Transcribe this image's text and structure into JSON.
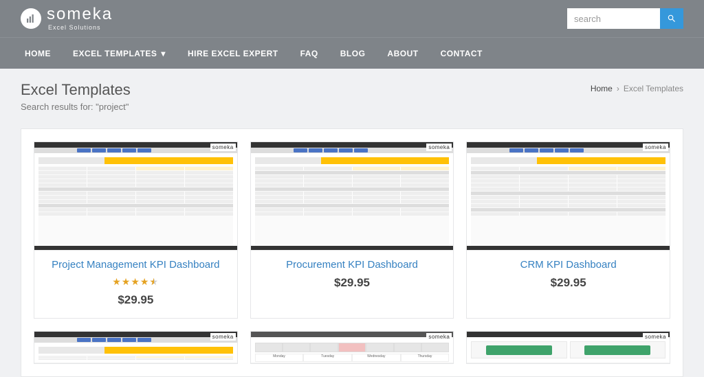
{
  "logo": {
    "main": "someka",
    "sub": "Excel Solutions"
  },
  "search": {
    "placeholder": "search"
  },
  "nav": {
    "home": "HOME",
    "templates": "EXCEL TEMPLATES",
    "hire": "HIRE EXCEL EXPERT",
    "faq": "FAQ",
    "blog": "BLOG",
    "about": "ABOUT",
    "contact": "CONTACT"
  },
  "page": {
    "title": "Excel Templates",
    "subtitle": "Search results for: \"project\""
  },
  "breadcrumb": {
    "home": "Home",
    "current": "Excel Templates"
  },
  "products": [
    {
      "title": "Project Management KPI Dashboard",
      "price": "$29.95",
      "rating": 4.5
    },
    {
      "title": "Procurement KPI Dashboard",
      "price": "$29.95",
      "rating": 0
    },
    {
      "title": "CRM KPI Dashboard",
      "price": "$29.95",
      "rating": 0
    }
  ],
  "thumb_brand": "someka"
}
